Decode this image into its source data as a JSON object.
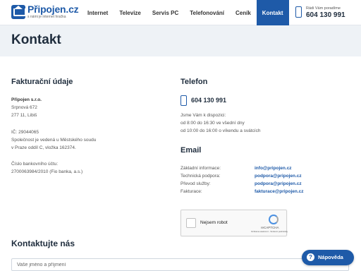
{
  "header": {
    "brand": "Připojen.cz",
    "tagline": "s námi je internet hračka",
    "nav": [
      "Internet",
      "Televize",
      "Servis PC",
      "Telefonování",
      "Ceník",
      "Kontakt"
    ],
    "active_nav": "Kontakt",
    "phone_label": "Rádi Vám poradíme",
    "phone": "604 130 991"
  },
  "page": {
    "title": "Kontakt"
  },
  "billing": {
    "heading": "Fakturační údaje",
    "company": "Připojen s.r.o.",
    "street": "Srpnová 672",
    "city": "277 11, Libiš",
    "ico": "IČ: 29044065",
    "registry_1": "Společnost je vedená u Městského soudu",
    "registry_2": "v Praze oddíl C, vložka 162374.",
    "bank_label": "Číslo bankovního účtu:",
    "bank_account": "2700063984/2010 (Fio banka, a.s.)"
  },
  "phone_section": {
    "heading": "Telefon",
    "number": "604 130 991",
    "hours_label": "Jsme Vám k dispozici:",
    "hours_weekday": "od 8:00 do 16:30 ve všední dny",
    "hours_weekend": "od 10:00 do 16:00 o víkendu a svátcích"
  },
  "email_section": {
    "heading": "Email",
    "rows": [
      {
        "label": "Základní informace:",
        "value": "info@pripojen.cz"
      },
      {
        "label": "Technická podpora:",
        "value": "podpora@pripojen.cz"
      },
      {
        "label": "Převod služby:",
        "value": "podpora@pripojen.cz"
      },
      {
        "label": "Fakturace:",
        "value": "fakturace@pripojen.cz"
      }
    ]
  },
  "captcha": {
    "label": "Nejsem robot",
    "brand": "reCAPTCHA",
    "terms": "Ochrana soukromí - Smluvní podmínky"
  },
  "contact_form": {
    "heading": "Kontaktujte nás",
    "name_placeholder": "Vaše jméno a příjmení"
  },
  "help": {
    "label": "Nápověda"
  },
  "colors": {
    "brand": "#1e5aa8",
    "title_band": "#eef2f6",
    "heading": "#1f2d3d"
  }
}
